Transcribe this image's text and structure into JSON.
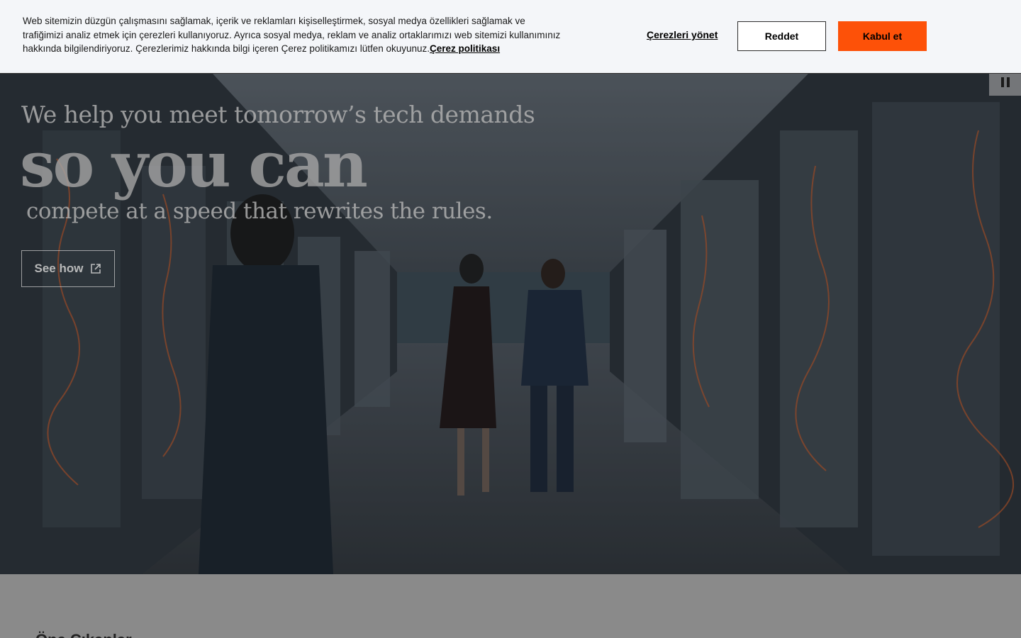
{
  "cookie_banner": {
    "text": "Web sitemizin düzgün çalışmasını sağlamak, içerik ve reklamları kişiselleştirmek, sosyal medya özellikleri sağlamak ve trafiğimizi analiz etmek için çerezleri kullanıyoruz. Ayrıca sosyal medya, reklam ve analiz ortaklarımızı web sitemizi kullanımınız hakkında bilgilendiriyoruz. Çerezlerimiz hakkında bilgi içeren Çerez politikamızı lütfen okuyunuz.",
    "policy_link": "Çerez politikası",
    "manage_label": "Çerezleri yönet",
    "reject_label": "Reddet",
    "accept_label": "Kabul et",
    "accent_color": "#fd5108"
  },
  "hero": {
    "line1": "We help you meet tomorrow’s tech demands",
    "line2": "so you can",
    "line3": "compete at a speed that rewrites the rules.",
    "cta_label": "See how",
    "cta_icon": "external-link-icon",
    "pause_icon": "pause-icon"
  },
  "below": {
    "heading": "Öne Çıkanlar"
  }
}
